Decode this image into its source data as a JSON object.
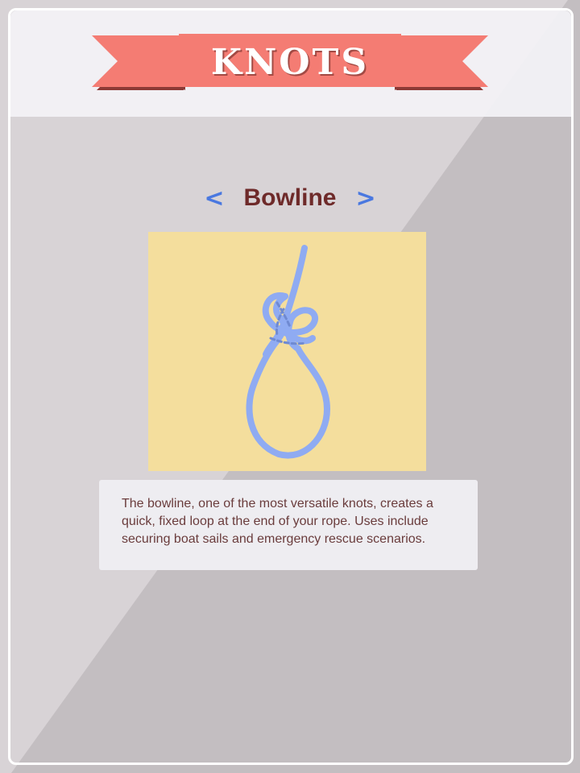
{
  "header": {
    "title": "KNOTS"
  },
  "knot": {
    "name": "Bowline",
    "prev_symbol": "<",
    "next_symbol": ">",
    "description": "The bowline, one of the most versatile knots, creates a quick, fixed loop at the end of your rope. Uses include securing boat sails and emergency rescue scenarios."
  },
  "icons": {
    "prev": "chevron-left-icon",
    "next": "chevron-right-icon",
    "illustration": "bowline-knot-illustration"
  },
  "colors": {
    "banner": "#f47c73",
    "banner_shadow": "#8c3a36",
    "title_text": "#6e2a2a",
    "arrow": "#4a78e0",
    "rope": "#8fabf2",
    "illustration_bg": "#f4de9d",
    "panel": "#eeedf1"
  }
}
